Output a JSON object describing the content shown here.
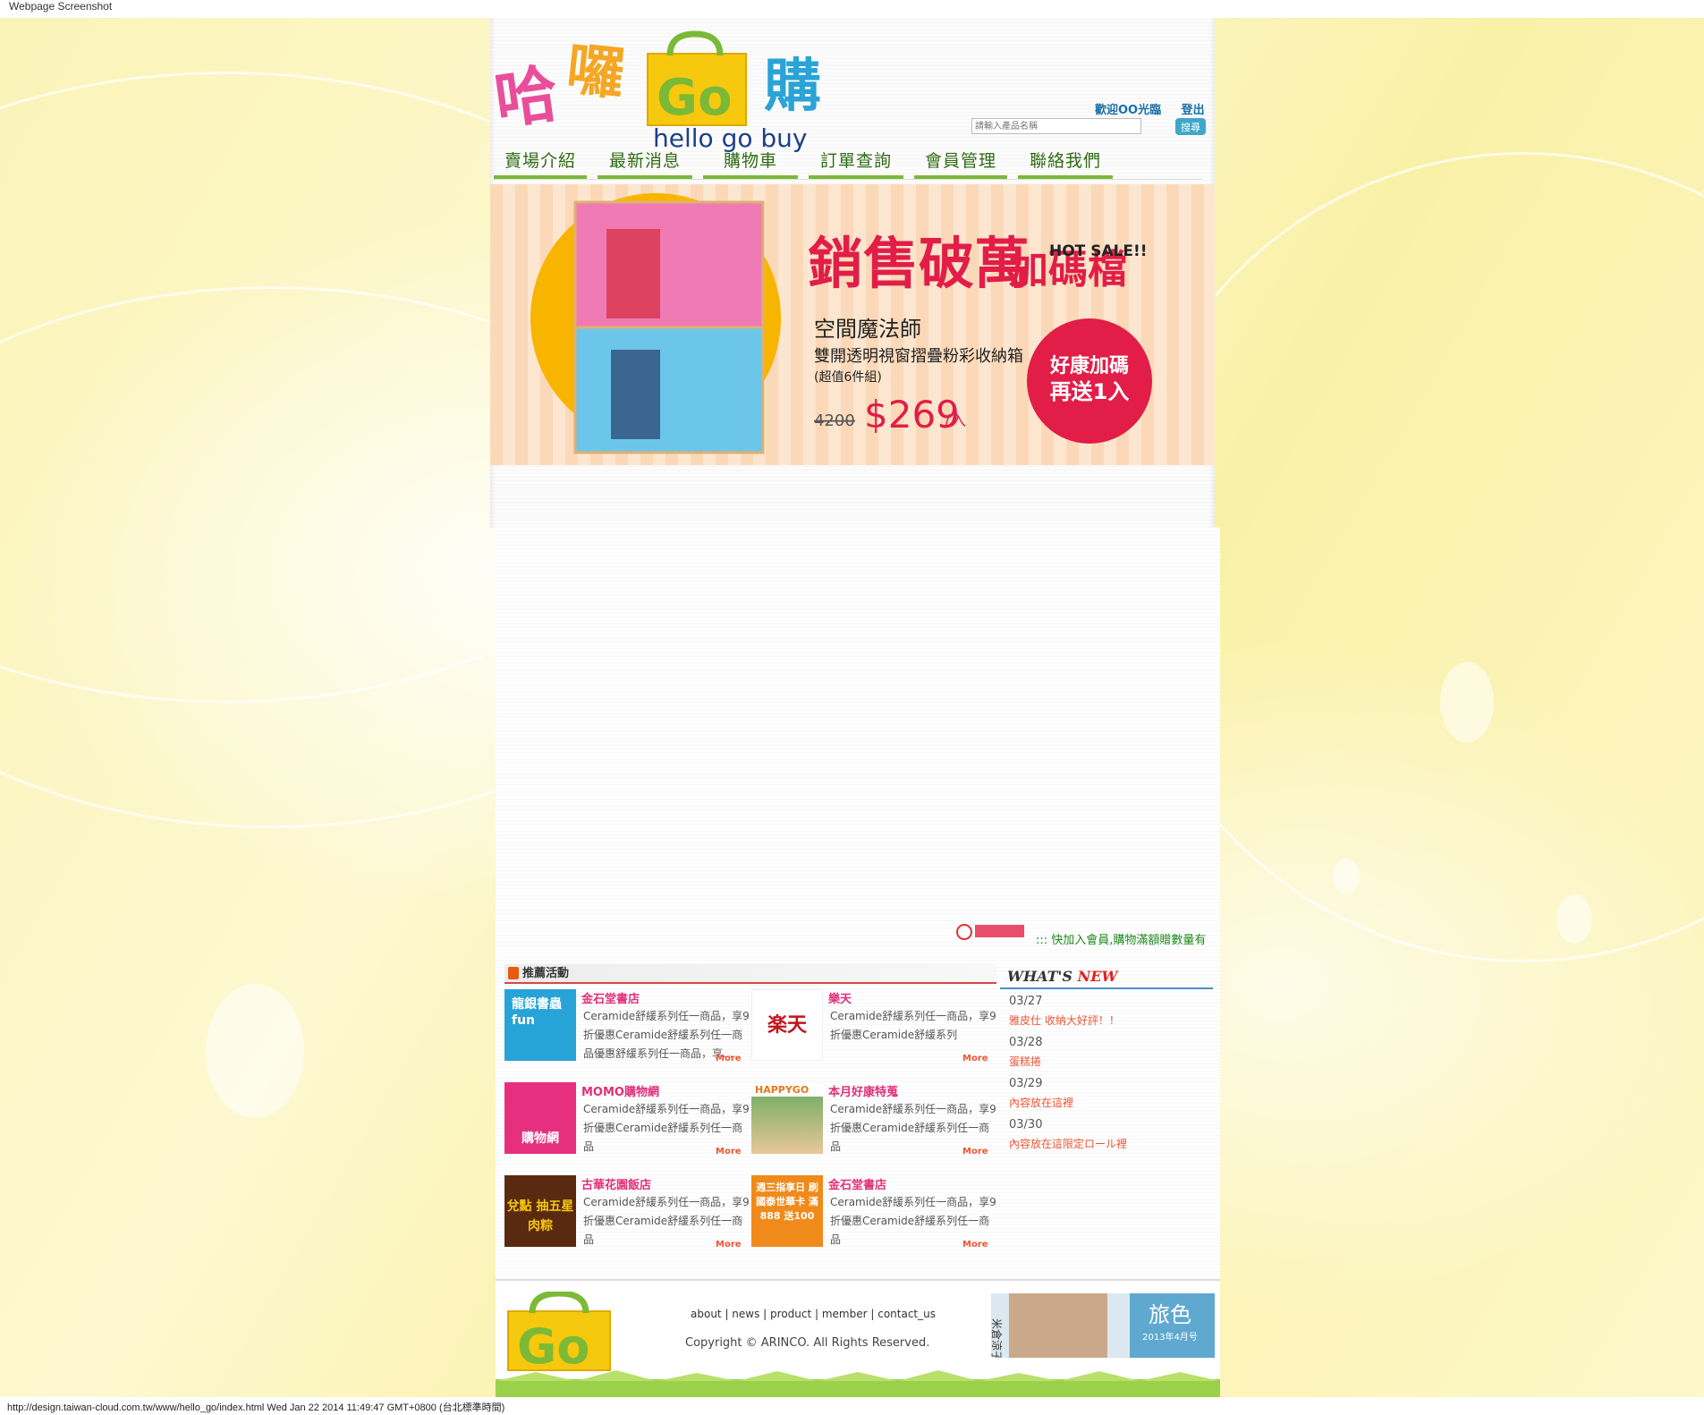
{
  "screenshot_title": "Webpage Screenshot",
  "footer_url": "http://design.taiwan-cloud.com.tw/www/hello_go/index.html Wed Jan 22 2014 11:49:47 GMT+0800 (台北標準時間)",
  "logo": {
    "chars": [
      "哈",
      "囉",
      "Go",
      "購"
    ],
    "subtitle": "hello  go  buy"
  },
  "header": {
    "welcome": "歡迎OO光臨",
    "logout": "登出",
    "search_placeholder": "請輸入產品名稱",
    "search_button": "搜尋"
  },
  "nav": [
    "賣場介紹",
    "最新消息",
    "購物車",
    "訂單查詢",
    "會員管理",
    "聯絡我們"
  ],
  "banner": {
    "headline": "銷售破萬",
    "headline2": "加碼檔",
    "hot": "HOT SALE!!",
    "brand": "空間魔法師",
    "product": "雙開透明視窗摺疊粉彩收納箱",
    "set": "(超值6件組)",
    "old_price": "4200",
    "price": "$269",
    "unit": "/入",
    "badge1": "好康加碼",
    "badge2": "再送1入"
  },
  "ticker": "::: 快加入會員,購物滿額贈數量有",
  "promos_title": "推薦活動",
  "promos": [
    {
      "title": "金石堂書店",
      "desc": "Ceramide舒緩系列任一商品，享9折優惠Ceramide舒緩系列任一商品優惠舒緩系列任一商品，享...",
      "more": "More",
      "thumb": "龍銀書蟲fun"
    },
    {
      "title": "樂天",
      "desc": "Ceramide舒緩系列任一商品，享9折優惠Ceramide舒緩系列",
      "more": "More",
      "thumb": "楽天"
    },
    {
      "title": "MOMO購物網",
      "desc": "Ceramide舒緩系列任一商品，享9折優惠Ceramide舒緩系列任一商品",
      "more": "More",
      "thumb": "購物網"
    },
    {
      "title": "本月好康特蒐",
      "desc": "Ceramide舒緩系列任一商品，享9折優惠Ceramide舒緩系列任一商品",
      "more": "More",
      "thumb": "HAPPYGO"
    },
    {
      "title": "古華花園飯店",
      "desc": "Ceramide舒緩系列任一商品，享9折優惠Ceramide舒緩系列任一商品",
      "more": "More",
      "thumb": "兌點 抽五星肉粽"
    },
    {
      "title": "金石堂書店",
      "desc": "Ceramide舒緩系列任一商品，享9折優惠Ceramide舒緩系列任一商品",
      "more": "More",
      "thumb": "週三指享日 刷國泰世華卡 滿888 送100"
    }
  ],
  "whatsnew": {
    "title_a": "WHAT'S ",
    "title_b": "NEW",
    "items": [
      {
        "date": "03/27",
        "text": "雅皮仕 收納大好評！！"
      },
      {
        "date": "03/28",
        "text": "蛋糕捲"
      },
      {
        "date": "03/29",
        "text": "內容放在這裡"
      },
      {
        "date": "03/30",
        "text": "內容放在這限定ロール裡"
      }
    ]
  },
  "footer": {
    "links": [
      "about",
      "news",
      "product",
      "member",
      "contact_us"
    ],
    "copyright": "Copyright © ARINCO. All Rights Reserved.",
    "magazine_title": "旅色",
    "magazine_date": "2013年4月号",
    "magazine_name": "米倉涼子"
  },
  "colors": {
    "nav_text": "#2f6b14",
    "nav_underline": "#7cb936",
    "promo_title": "#e0307a",
    "more": "#e53",
    "link_blue": "#1a6fa8"
  }
}
